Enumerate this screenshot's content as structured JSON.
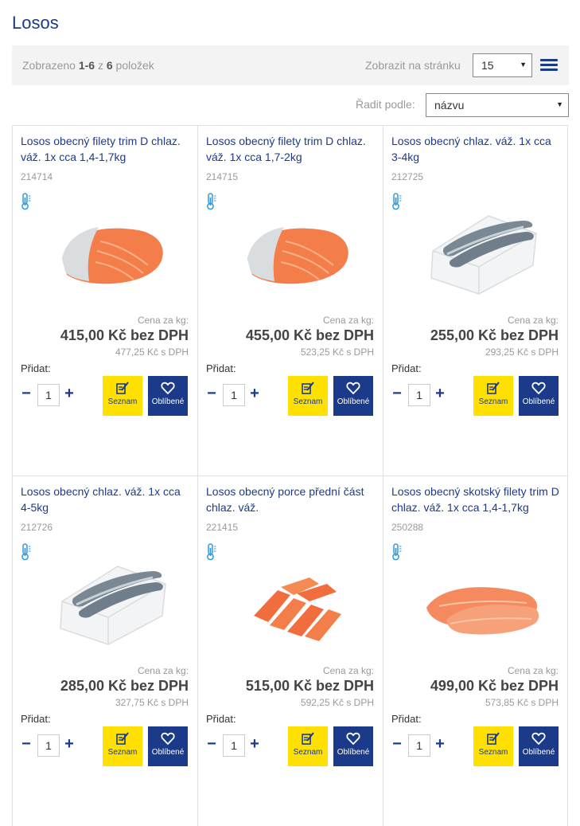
{
  "page": {
    "title": "Losos"
  },
  "toolbar": {
    "count_prefix": "Zobrazeno",
    "count_range": "1-6",
    "count_of": "z",
    "count_total": "6",
    "count_suffix": "položek",
    "perpage_label": "Zobrazit na stránku",
    "perpage_value": "15",
    "sort_label": "Řadit podle:",
    "sort_value": "názvu"
  },
  "colors": {
    "brand_blue": "#1b3a8a",
    "accent_yellow": "#ffe000"
  },
  "products": [
    {
      "name": "Losos obecný filety trim D chlaz. váž. 1x cca 1,4-1,7kg",
      "code": "214714",
      "per_kg_label": "Cena za kg:",
      "price": "415,00 Kč bez DPH",
      "price_vat": "477,25 Kč s DPH",
      "add_label": "Přidat:",
      "qty": "1",
      "list_label": "Seznam",
      "fav_label": "Oblíbené",
      "image": "salmon-fillet"
    },
    {
      "name": "Losos obecný filety trim D chlaz. váž. 1x cca 1,7-2kg",
      "code": "214715",
      "per_kg_label": "Cena za kg:",
      "price": "455,00 Kč bez DPH",
      "price_vat": "523,25 Kč s DPH",
      "add_label": "Přidat:",
      "qty": "1",
      "list_label": "Seznam",
      "fav_label": "Oblíbené",
      "image": "salmon-fillet"
    },
    {
      "name": "Losos obecný chlaz. váž. 1x cca 3-4kg",
      "code": "212725",
      "per_kg_label": "Cena za kg:",
      "price": "255,00 Kč bez DPH",
      "price_vat": "293,25 Kč s DPH",
      "add_label": "Přidat:",
      "qty": "1",
      "list_label": "Seznam",
      "fav_label": "Oblíbené",
      "image": "whole-salmon-box"
    },
    {
      "name": "Losos obecný chlaz. váž. 1x cca 4-5kg",
      "code": "212726",
      "per_kg_label": "Cena za kg:",
      "price": "285,00 Kč bez DPH",
      "price_vat": "327,75 Kč s DPH",
      "add_label": "Přidat:",
      "qty": "1",
      "list_label": "Seznam",
      "fav_label": "Oblíbené",
      "image": "whole-salmon-box"
    },
    {
      "name": "Losos obecný porce přední část chlaz. váž.",
      "code": "221415",
      "per_kg_label": "Cena za kg:",
      "price": "515,00 Kč bez DPH",
      "price_vat": "592,25 Kč s DPH",
      "add_label": "Přidat:",
      "qty": "1",
      "list_label": "Seznam",
      "fav_label": "Oblíbené",
      "image": "salmon-portions"
    },
    {
      "name": "Losos obecný skotský filety trim D chlaz. váž. 1x cca 1,4-1,7kg",
      "code": "250288",
      "per_kg_label": "Cena za kg:",
      "price": "499,00 Kč bez DPH",
      "price_vat": "573,85 Kč s DPH",
      "add_label": "Přidat:",
      "qty": "1",
      "list_label": "Seznam",
      "fav_label": "Oblíbené",
      "image": "salmon-fillets-pair"
    }
  ]
}
